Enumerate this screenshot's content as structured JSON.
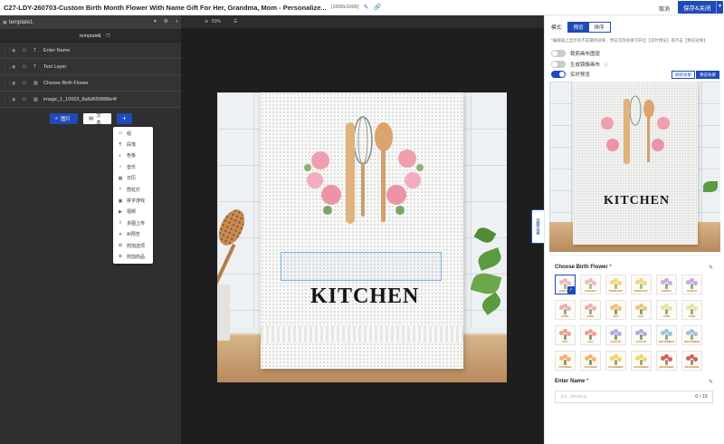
{
  "app": {
    "title": "C27-LDY-260703-Custom Birth Month Flower With Name Gift For Her, Grandma, Mom - Personalize...",
    "dimensions": "(1000x1000)",
    "cancel_label": "取消",
    "save_label": "保存&关闭"
  },
  "left_panel": {
    "template_tab": "template1",
    "template_name": "template1",
    "layers": [
      {
        "label": "Enter Name",
        "type_icon": "text-icon"
      },
      {
        "label": "Text Layer",
        "type_icon": "text-icon"
      },
      {
        "label": "Choose Birth Flower",
        "type_icon": "image-icon"
      },
      {
        "label": "image_1_10003_8a6d650888e4f",
        "type_icon": "image-icon"
      }
    ],
    "add_image_label": "图片",
    "add_text_label": "文本",
    "add_more_label": "+",
    "add_menu": [
      {
        "label": "组",
        "icon": "folder-icon"
      },
      {
        "label": "段落",
        "icon": "paragraph-icon"
      },
      {
        "label": "色板",
        "icon": "palette-icon"
      },
      {
        "label": "音乐",
        "icon": "music-icon"
      },
      {
        "label": "日历",
        "icon": "calendar-icon"
      },
      {
        "label": "霓虹灯",
        "icon": "neon-icon"
      },
      {
        "label": "拼字游戏",
        "icon": "scrabble-icon"
      },
      {
        "label": "视频",
        "icon": "video-icon"
      },
      {
        "label": "多图上传",
        "icon": "upload-icon"
      },
      {
        "label": "AI预览",
        "icon": "ai-icon"
      },
      {
        "label": "附加选项",
        "icon": "addon-icon"
      },
      {
        "label": "附加商品",
        "icon": "addon-product-icon"
      }
    ]
  },
  "canvas": {
    "zoom": "83%",
    "product_text": "KITCHEN"
  },
  "right_panel": {
    "mode_label": "模式:",
    "tabs": {
      "preview": "预览",
      "sort": "排序"
    },
    "note": "*编辑器上显示的不是最终效果，预览实际效果可开启【实时预览】或点击【预览效果】",
    "toggles": [
      {
        "label": "裁剪画布图层",
        "on": false
      },
      {
        "label": "生成镜像画布",
        "on": false
      },
      {
        "label": "实时预览",
        "on": true
      }
    ],
    "refresh_label": "刷新效果",
    "preview_effect_label": "预览效果",
    "side_tab": "提醒设置",
    "birth_flower": {
      "title": "Choose Birth Flower",
      "required": "*",
      "months": [
        "JANUARY",
        "JANUARY",
        "FEBRUARY",
        "FEBRUARY",
        "MARCH",
        "MARCH",
        "APRIL",
        "APRIL",
        "MAY",
        "MAY",
        "JUNE",
        "JUNE",
        "JULY",
        "JULY",
        "AUGUST",
        "AUGUST",
        "SEPTEMBER",
        "SEPTEMBER",
        "OCTOBER",
        "OCTOBER",
        "NOVEMBER",
        "NOVEMBER",
        "DECEMBER",
        "DECEMBER"
      ],
      "selected_index": 0
    },
    "enter_name": {
      "title": "Enter Name",
      "required": "*",
      "placeholder": "Ex: Jessica",
      "counter": "0 / 15"
    }
  },
  "colors": {
    "accent": "#1f4bb8",
    "panel_dark": "#2f2f2f",
    "canvas_bg": "#1e1e1e"
  }
}
